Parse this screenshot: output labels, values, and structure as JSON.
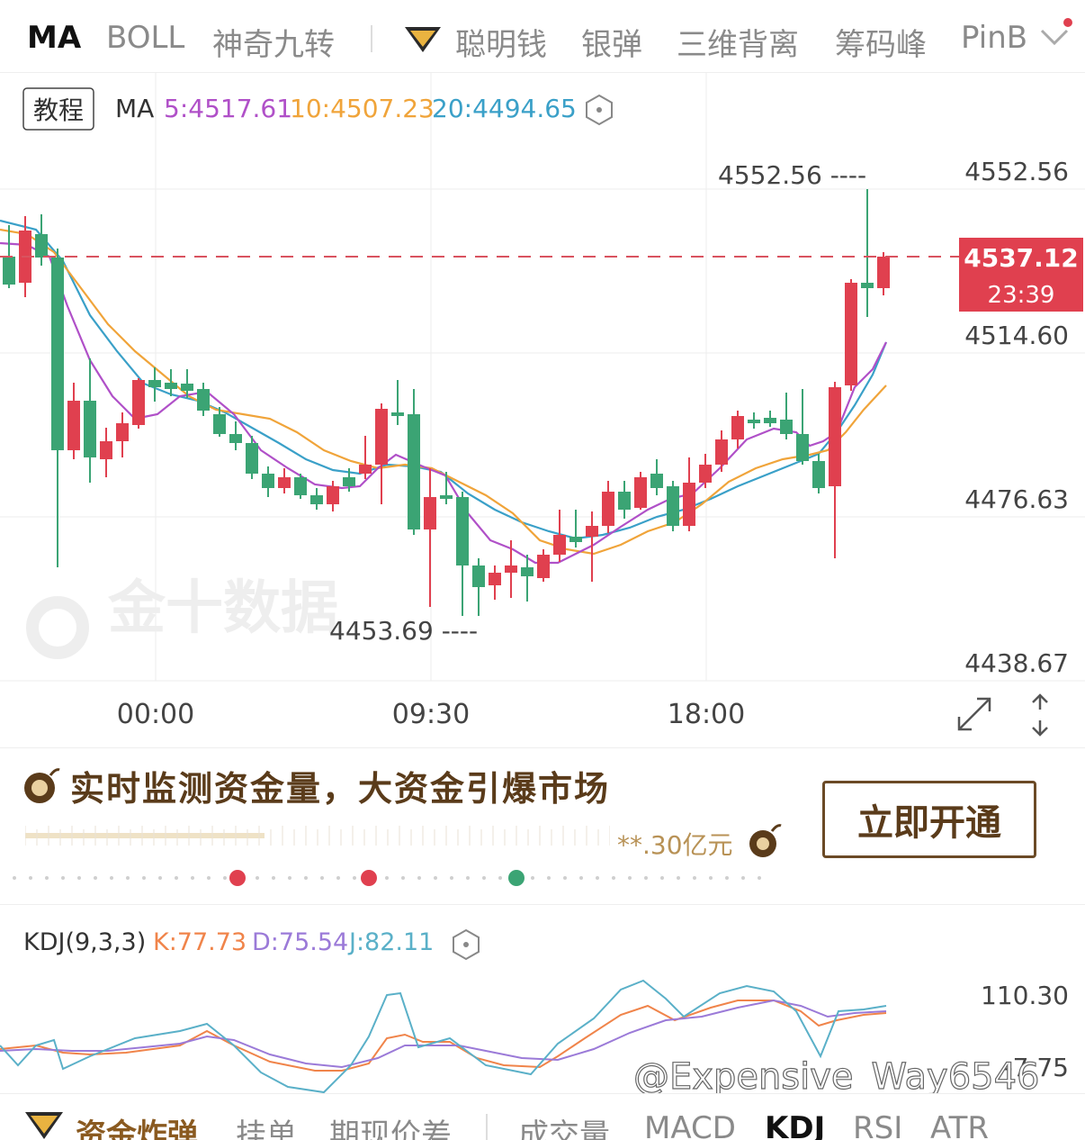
{
  "indicator_tabs": [
    "MA",
    "BOLL",
    "神奇九转",
    "聪明钱",
    "银弹",
    "三维背离",
    "筹码峰",
    "PinB"
  ],
  "chart": {
    "tutorial_label": "教程",
    "ma_label": "MA",
    "ma5": "5:4517.61",
    "ma10": "10:4507.23",
    "ma20": "20:4494.65",
    "price_labels": [
      "4552.56",
      "4514.60",
      "4476.63",
      "4438.67"
    ],
    "high_marker": "4552.56 ----",
    "low_marker": "4453.69 ----",
    "current_price": "4537.12",
    "countdown": "23:39",
    "watermark": "金十数据",
    "time_labels": [
      "00:00",
      "09:30",
      "18:00"
    ],
    "colors": {
      "up": "#e0404f",
      "down": "#3ba474",
      "ma5": "#b050c8",
      "ma10": "#f0a43a",
      "ma20": "#3aa0c8"
    }
  },
  "promo": {
    "title": "实时监测资金量，大资金引爆市场",
    "value": "**.30亿元",
    "button": "立即开通"
  },
  "kdj": {
    "label": "KDJ(9,3,3)",
    "k": "K:77.73",
    "d": "D:75.54",
    "j": "J:82.11",
    "axis_top": "110.30",
    "axis_bottom": "-7.75"
  },
  "watermark_user": "@Expensive_Way6546",
  "bottom_tabs": [
    "资金炸弹",
    "挂单",
    "期现价差",
    "成交量",
    "MACD",
    "KDJ",
    "RSI",
    "ATR"
  ]
}
